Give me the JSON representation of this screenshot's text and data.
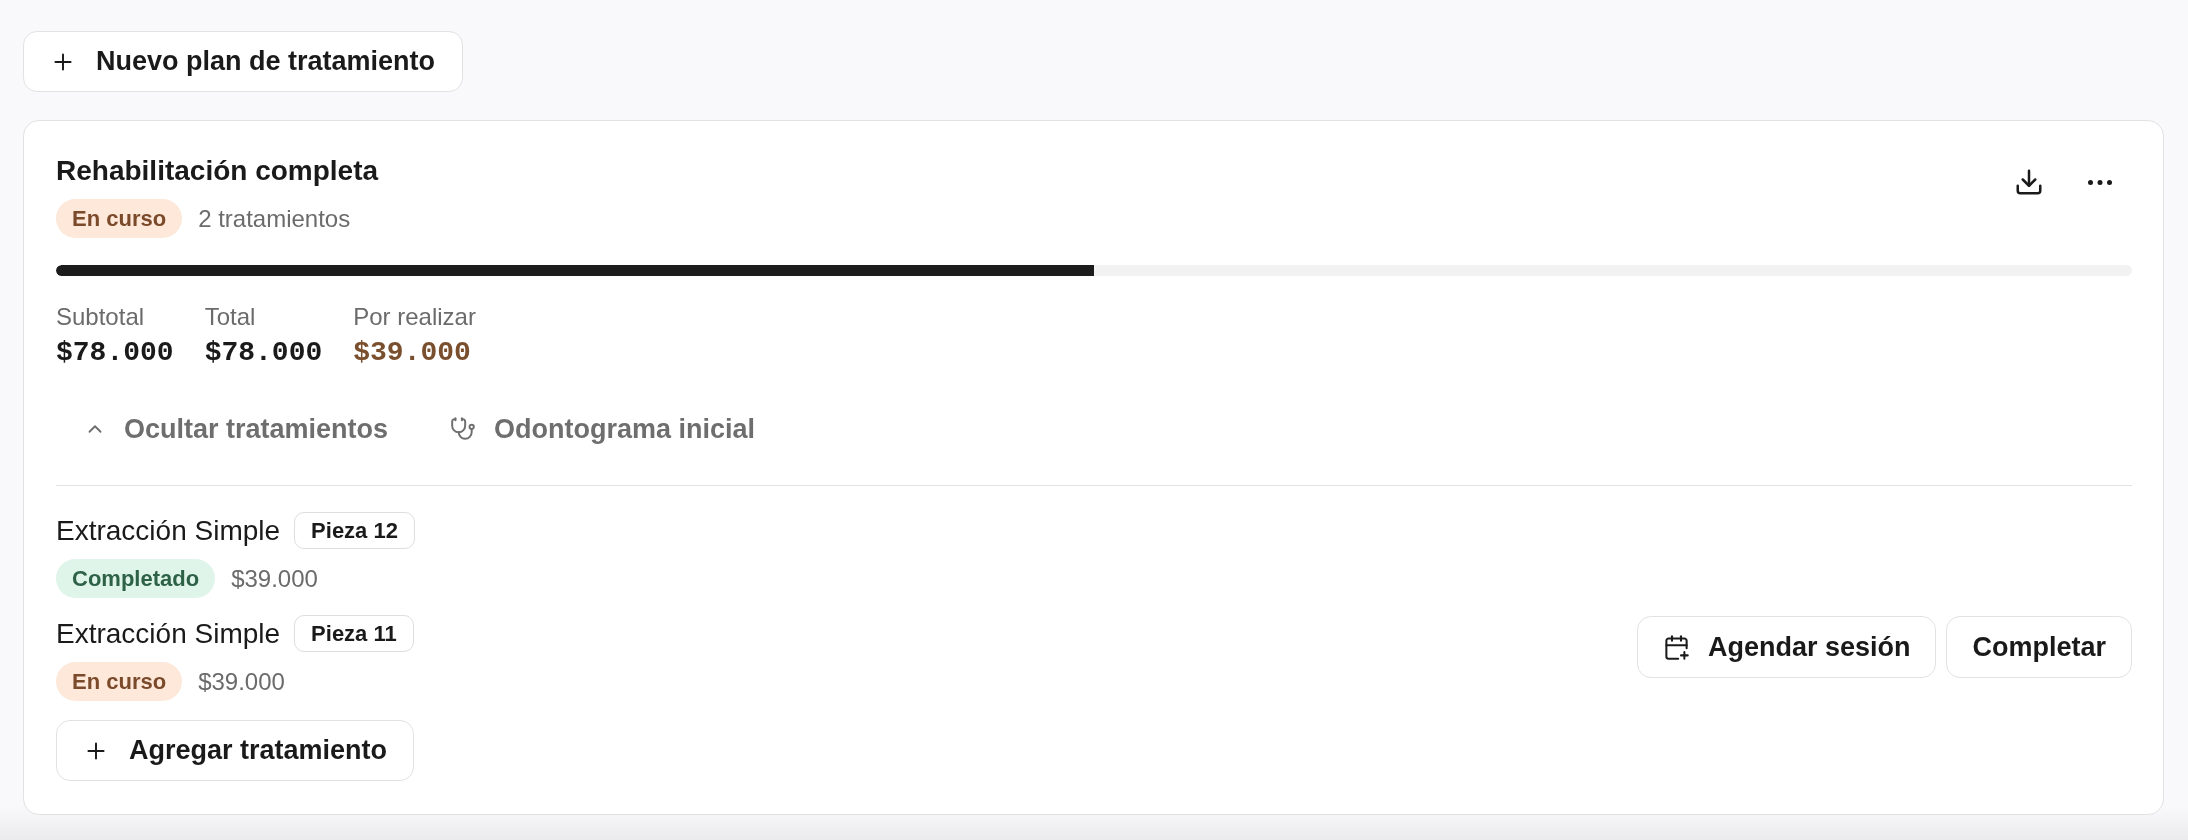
{
  "toolbar": {
    "new_plan_button": "Nuevo plan de tratamiento"
  },
  "plan": {
    "title": "Rehabilitación completa",
    "status": {
      "label": "En curso",
      "kind": "in_progress"
    },
    "treatment_count": "2 tratamientos",
    "progress": {
      "level": 0.5
    },
    "totals": [
      {
        "label": "Subtotal",
        "value": "$78.000",
        "kind": "normal"
      },
      {
        "label": "Total",
        "value": "$78.000",
        "kind": "normal"
      },
      {
        "label": "Por realizar",
        "value": "$39.000",
        "kind": "pending"
      }
    ],
    "actions": [
      {
        "label": "Ocultar tratamientos",
        "kind": "collapse",
        "expanded": true
      },
      {
        "label": "Odontograma inicial",
        "kind": "odontogram"
      }
    ],
    "treatments": [
      {
        "name": "Extracción Simple",
        "tooth": "Pieza 12",
        "status": {
          "label": "Completado",
          "kind": "completed"
        },
        "price": "$39.000"
      },
      {
        "name": "Extracción Simple",
        "tooth": "Pieza 11",
        "status": {
          "label": "En curso",
          "kind": "in_progress"
        },
        "price": "$39.000",
        "buttons": [
          {
            "label": "Agendar sesión",
            "kind": "schedule"
          },
          {
            "label": "Completar",
            "kind": "complete"
          }
        ]
      }
    ],
    "add_button": "Agregar tratamiento"
  }
}
